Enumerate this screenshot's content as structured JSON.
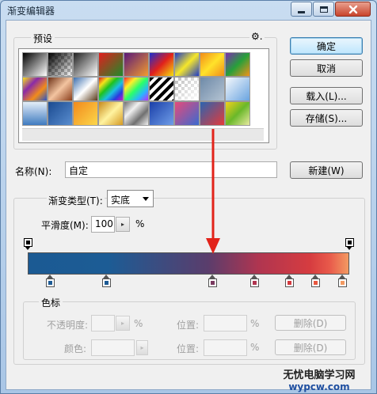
{
  "window": {
    "title": "渐变编辑器",
    "min_icon": "minimize-icon",
    "max_icon": "maximize-icon",
    "close_icon": "close-icon"
  },
  "presets": {
    "legend": "预设",
    "gear_glyph": "⚙.",
    "swatches": [
      {
        "name": "black-white",
        "bg": "linear-gradient(135deg,#000,#fff)"
      },
      {
        "name": "black-transparent",
        "bg": "linear-gradient(135deg,#000,rgba(0,0,0,0))"
      },
      {
        "name": "gray-white",
        "bg": "linear-gradient(135deg,#222,#fff)"
      },
      {
        "name": "red-green",
        "bg": "linear-gradient(135deg,#e21e1e,#1e8a2a)"
      },
      {
        "name": "violet-orange",
        "bg": "linear-gradient(135deg,#5a1a7a,#f29a2e)"
      },
      {
        "name": "blue-red-yellow",
        "bg": "linear-gradient(135deg,#1a2fd0,#e0201c,#f5e20e)"
      },
      {
        "name": "blue-yellow-blue",
        "bg": "linear-gradient(135deg,#1f3cc8,#f6e72a,#1f3cc8)"
      },
      {
        "name": "orange-yellow-orange",
        "bg": "linear-gradient(135deg,#f28c1a,#ffe22a,#f28c1a)"
      },
      {
        "name": "violet-green-orange",
        "bg": "linear-gradient(135deg,#7a2fb0,#27a03a,#f2921c)"
      },
      {
        "name": "yellow-violet-orange-blue",
        "bg": "linear-gradient(135deg,#f7e21a,#8a2aa8,#f28c1a,#2a54c8)"
      },
      {
        "name": "copper",
        "bg": "linear-gradient(135deg,#6e3218,#f3c4a0,#8a3e1c)"
      },
      {
        "name": "chrome",
        "bg": "linear-gradient(135deg,#3d6fae,#ffffff,#5a3a1a)"
      },
      {
        "name": "spectrum",
        "bg": "linear-gradient(135deg,#e01c1c,#f5e21a,#1ec21e,#1cc0e0,#2a3ae0,#c21cc2)"
      },
      {
        "name": "transparent-rainbow",
        "bg": "linear-gradient(135deg,#ff2a2a,#ffee2a,#2aff6a,#2ab4ff,#c02aff)"
      },
      {
        "name": "transparent-stripes",
        "bg": "repeating-linear-gradient(135deg,#000 0 4px,#fff 4px 8px)"
      },
      {
        "name": "transparent-white",
        "bg": "linear-gradient(135deg,rgba(255,255,255,0),#fff)"
      },
      {
        "name": "blue-gray",
        "bg": "linear-gradient(135deg,#6e8aa8,#b4c3d2)"
      },
      {
        "name": "blue-sky",
        "bg": "linear-gradient(135deg,#f5f8fc,#6aa4e0)"
      },
      {
        "name": "steel-blue",
        "bg": "linear-gradient(180deg,#e4eef8,#3f7bc0)"
      },
      {
        "name": "navy-blue",
        "bg": "linear-gradient(135deg,#1a4a90,#5a8ed0)"
      },
      {
        "name": "orange-yellow",
        "bg": "linear-gradient(135deg,#f28a1c,#fcd74a)"
      },
      {
        "name": "gold-yellow",
        "bg": "linear-gradient(135deg,#c88a1a,#fff3a0,#d59a22)"
      },
      {
        "name": "silver",
        "bg": "linear-gradient(135deg,#707070,#f0f0f0,#707070,#f0f0f0)"
      },
      {
        "name": "royal-blue",
        "bg": "linear-gradient(135deg,#1a3fa8,#6f9de8)"
      },
      {
        "name": "pink-blue",
        "bg": "linear-gradient(135deg,#e64a7a,#3a6ad0)"
      },
      {
        "name": "red-orange",
        "bg": "linear-gradient(135deg,#2a64b0,#e43a3a)"
      },
      {
        "name": "yellow-green",
        "bg": "linear-gradient(135deg,#f3d11a,#6ab82a,#e8eaa0)"
      }
    ]
  },
  "buttons": {
    "ok": "确定",
    "cancel": "取消",
    "load": "载入(L)...",
    "save": "存储(S)...",
    "new": "新建(W)"
  },
  "name_row": {
    "label": "名称(N):",
    "value": "自定"
  },
  "gradient": {
    "type_label": "渐变类型(T):",
    "type_value": "实底",
    "smooth_label": "平滑度(M):",
    "smooth_value": "100",
    "smooth_unit": "%",
    "color_stops": [
      {
        "position": 0.07,
        "color": "#1d5b94"
      },
      {
        "position": 0.245,
        "color": "#1d5b94"
      },
      {
        "position": 0.575,
        "color": "#7a3a60"
      },
      {
        "position": 0.705,
        "color": "#b0344f"
      },
      {
        "position": 0.815,
        "color": "#d33a3f"
      },
      {
        "position": 0.895,
        "color": "#e8573f"
      },
      {
        "position": 0.98,
        "color": "#f39a62"
      }
    ],
    "opacity_stops": [
      {
        "position": 0.0,
        "opacity": 1
      },
      {
        "position": 1.0,
        "opacity": 1
      }
    ],
    "annotation_color": "#e2231a"
  },
  "stops_panel": {
    "legend": "色标",
    "opacity_label": "不透明度:",
    "opacity_unit": "%",
    "location_label": "位置:",
    "location_unit": "%",
    "delete_label": "删除(D)",
    "color_label": "颜色:",
    "location_label_2": "位置:",
    "location_unit_2": "%",
    "delete_label_2": "删除(D)"
  },
  "watermark": {
    "line1": "无忧电脑学习网",
    "line2": "wypcw.com"
  }
}
